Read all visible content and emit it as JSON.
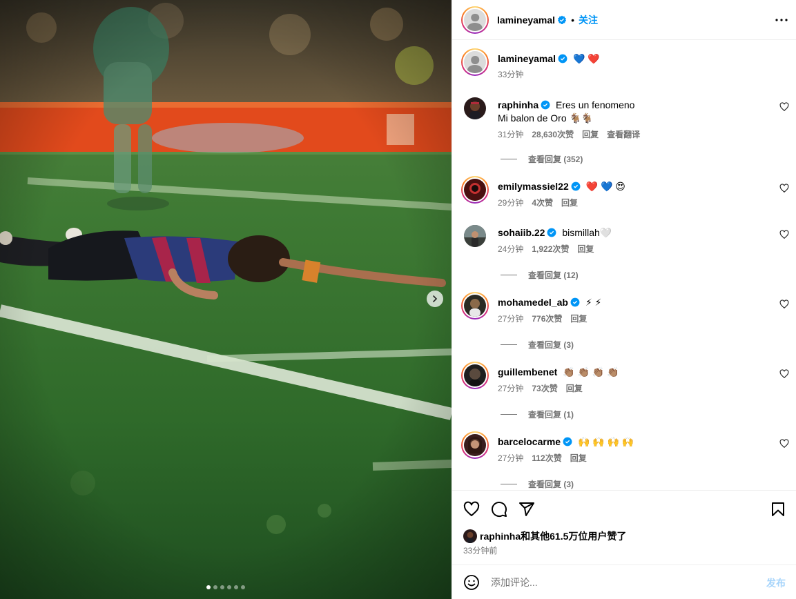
{
  "colors": {
    "accent": "#0095f6",
    "muted": "#737373",
    "verified": "#0095f6",
    "heart_red": "#ff3040"
  },
  "media": {
    "slide_count": 6,
    "active_slide": 1,
    "next_icon": "chevron-right-icon"
  },
  "header": {
    "username": "lamineyamal",
    "separator": "•",
    "follow_label": "关注",
    "more_icon": "more-horizontal-icon"
  },
  "caption": {
    "username": "lamineyamal",
    "emoji": "💙 ❤️",
    "time": "33分钟"
  },
  "comments": [
    {
      "username": "raphinha",
      "verified": true,
      "text": "Eres un fenomeno",
      "text2": "Mi balon de Oro 🐐🐐",
      "time": "31分钟",
      "likes": "28,630次赞",
      "reply": "回复",
      "translate": "查看翻译",
      "view_replies": "查看回复 (352)"
    },
    {
      "username": "emilymassiel22",
      "verified": true,
      "text": "❤️ 💙 😍",
      "time": "29分钟",
      "likes": "4次赞",
      "reply": "回复"
    },
    {
      "username": "sohaiib.22",
      "verified": true,
      "text": "bismillah🤍",
      "time": "24分钟",
      "likes": "1,922次赞",
      "reply": "回复",
      "view_replies": "查看回复 (12)"
    },
    {
      "username": "mohamedel_ab",
      "verified": true,
      "text": "⚡ ⚡",
      "time": "27分钟",
      "likes": "776次赞",
      "reply": "回复",
      "view_replies": "查看回复 (3)"
    },
    {
      "username": "guillembenet",
      "verified": false,
      "text": "👏🏽 👏🏽 👏🏽 👏🏽",
      "time": "27分钟",
      "likes": "73次赞",
      "reply": "回复",
      "view_replies": "查看回复 (1)"
    },
    {
      "username": "barcelocarme",
      "verified": true,
      "text": "🙌 🙌 🙌 🙌",
      "time": "27分钟",
      "likes": "112次赞",
      "reply": "回复",
      "view_replies": "查看回复 (3)"
    }
  ],
  "actions": {
    "like_icon": "heart-icon",
    "comment_icon": "comment-icon",
    "share_icon": "share-icon",
    "save_icon": "bookmark-icon"
  },
  "likes_summary": "raphinha和其他61.5万位用户赞了",
  "posted_ago": "33分钟前",
  "composer": {
    "emoji_icon": "smiley-icon",
    "placeholder": "添加评论...",
    "post_label": "发布"
  }
}
